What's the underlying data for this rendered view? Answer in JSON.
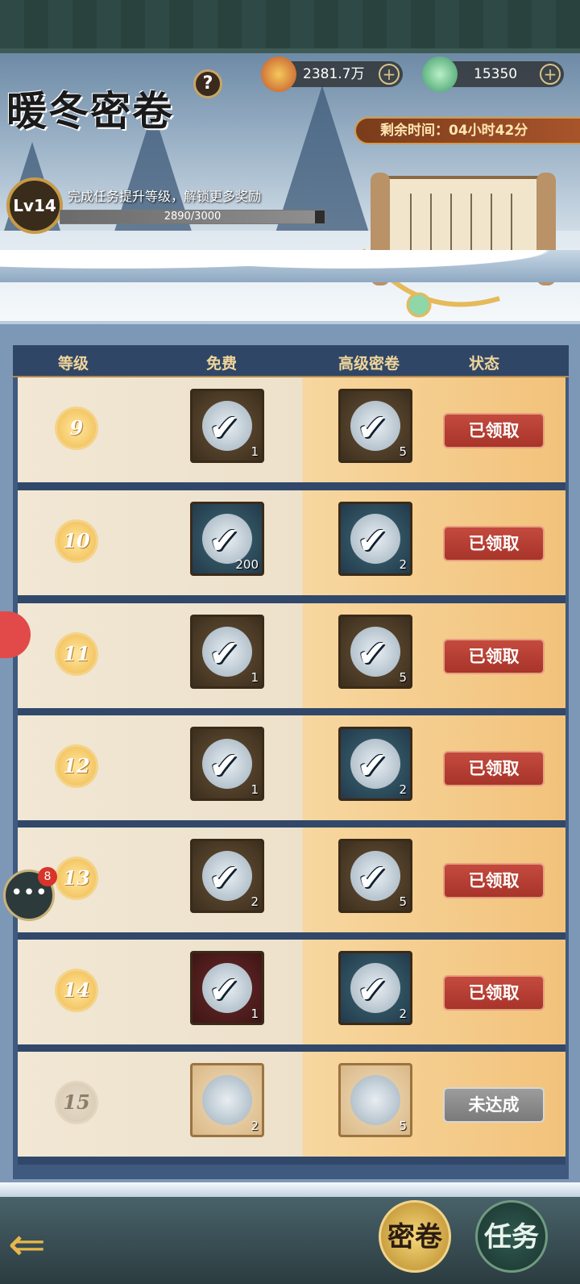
{
  "header": {
    "title": "暖冬密卷",
    "help_icon": "?",
    "currency_gold": "2381.7万",
    "currency_jade": "15350",
    "timer": "剩余时间：04小时42分"
  },
  "level": {
    "label": "Lv14",
    "description": "完成任务提升等级，解锁更多奖励",
    "progress_text": "2890/3000",
    "progress_fraction": 0.963
  },
  "table": {
    "headers": [
      "等级",
      "免费",
      "高级密卷",
      "状态"
    ],
    "rows": [
      {
        "level": "9",
        "free_qty": "1",
        "prem_qty": "5",
        "status": "已领取"
      },
      {
        "level": "10",
        "free_qty": "200",
        "prem_qty": "2",
        "status": "已领取"
      },
      {
        "level": "11",
        "free_qty": "1",
        "prem_qty": "5",
        "status": "已领取"
      },
      {
        "level": "12",
        "free_qty": "1",
        "prem_qty": "2",
        "status": "已领取"
      },
      {
        "level": "13",
        "free_qty": "2",
        "prem_qty": "5",
        "status": "已领取"
      },
      {
        "level": "14",
        "free_qty": "1",
        "prem_qty": "2",
        "status": "已领取"
      },
      {
        "level": "15",
        "free_qty": "2",
        "prem_qty": "5",
        "status": "未达成"
      }
    ]
  },
  "chat": {
    "badge": "8"
  },
  "tabs": {
    "active": "密卷",
    "other": "任务"
  },
  "colors": {
    "claimed_button": "#c44a3e",
    "locked_button": "#8a8a8a",
    "track": "#f2b84a"
  }
}
